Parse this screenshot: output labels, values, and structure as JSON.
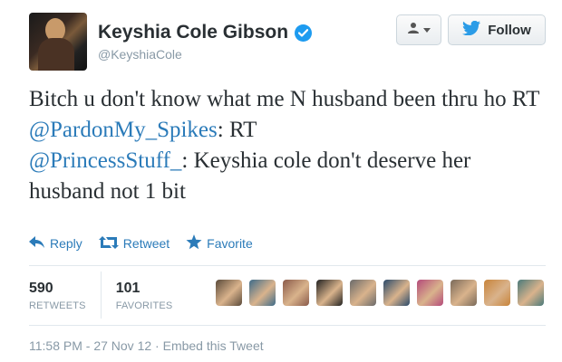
{
  "user": {
    "full_name": "Keyshia Cole Gibson",
    "username": "@KeyshiaCole",
    "verified": true,
    "avatar_icon": "profile-photo"
  },
  "buttons": {
    "user_menu_icon": "user-dropdown-icon",
    "follow_label": "Follow"
  },
  "tweet": {
    "segments": [
      {
        "text": "Bitch u don't know what me N husband been thru ho RT ",
        "type": "text"
      },
      {
        "text": "@PardonMy_Spikes",
        "type": "mention"
      },
      {
        "text": ": RT ",
        "type": "text"
      },
      {
        "text": "@PrincessStuff_",
        "type": "mention"
      },
      {
        "text": ": Keyshia cole don't deserve her husband not 1 bit",
        "type": "text"
      }
    ]
  },
  "actions": {
    "reply": "Reply",
    "retweet": "Retweet",
    "favorite": "Favorite"
  },
  "stats": {
    "retweets_count": "590",
    "retweets_label": "RETWEETS",
    "favorites_count": "101",
    "favorites_label": "FAVORITES"
  },
  "favoriter_avatars": [
    {
      "color": "#5a4a3a"
    },
    {
      "color": "#3d6b8a"
    },
    {
      "color": "#8a5a4a"
    },
    {
      "color": "#222222"
    },
    {
      "color": "#6a6a6a"
    },
    {
      "color": "#2a4a6a"
    },
    {
      "color": "#b44a7a"
    },
    {
      "color": "#7a6a5a"
    },
    {
      "color": "#c8843a"
    },
    {
      "color": "#4a7a7a"
    }
  ],
  "footer": {
    "timestamp": "11:58 PM - 27 Nov 12",
    "separator": "·",
    "embed_link": "Embed this Tweet"
  },
  "colors": {
    "link": "#2b7bb9",
    "verified": "#1d9bf0",
    "muted": "#8899a6",
    "text": "#292f33"
  }
}
